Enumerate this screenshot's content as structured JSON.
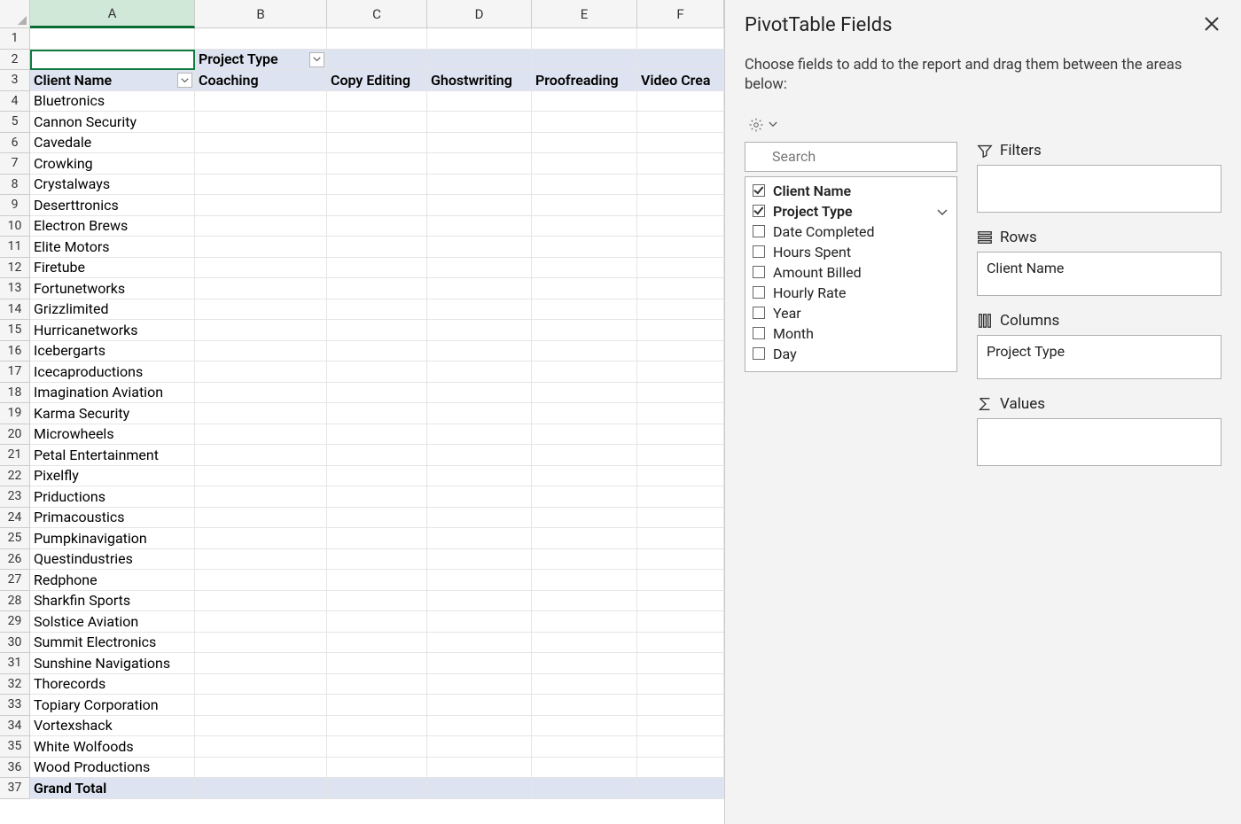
{
  "pane": {
    "title": "PivotTable Fields",
    "subtitle": "Choose fields to add to the report and drag them between the areas below:",
    "search_placeholder": "Search",
    "fields": [
      {
        "label": "Client Name",
        "checked": true,
        "chevron": false
      },
      {
        "label": "Project Type",
        "checked": true,
        "chevron": true
      },
      {
        "label": "Date Completed",
        "checked": false,
        "chevron": false
      },
      {
        "label": "Hours Spent",
        "checked": false,
        "chevron": false
      },
      {
        "label": "Amount Billed",
        "checked": false,
        "chevron": false
      },
      {
        "label": "Hourly Rate",
        "checked": false,
        "chevron": false
      },
      {
        "label": "Year",
        "checked": false,
        "chevron": false
      },
      {
        "label": "Month",
        "checked": false,
        "chevron": false
      },
      {
        "label": "Day",
        "checked": false,
        "chevron": false
      }
    ],
    "areas": {
      "filters_label": "Filters",
      "rows_label": "Rows",
      "columns_label": "Columns",
      "values_label": "Values",
      "rows_items": [
        "Client Name"
      ],
      "columns_items": [
        "Project Type"
      ]
    }
  },
  "sheet": {
    "columns": [
      "A",
      "B",
      "C",
      "D",
      "E",
      "F"
    ],
    "active_col": "A",
    "pivot": {
      "field_header_row": "Client Name",
      "field_header_col": "Project Type",
      "col_labels": [
        "Coaching",
        "Copy Editing",
        "Ghostwriting",
        "Proofreading",
        "Video Crea"
      ],
      "row_labels": [
        "Bluetronics",
        "Cannon Security",
        "Cavedale",
        "Crowking",
        "Crystalways",
        "Deserttronics",
        "Electron Brews",
        "Elite Motors",
        "Firetube",
        "Fortunetworks",
        "Grizzlimited",
        "Hurricanetworks",
        "Icebergarts",
        "Icecaproductions",
        "Imagination Aviation",
        "Karma Security",
        "Microwheels",
        "Petal Entertainment",
        "Pixelfly",
        "Priductions",
        "Primacoustics",
        "Pumpkinavigation",
        "Questindustries",
        "Redphone",
        "Sharkfin Sports",
        "Solstice Aviation",
        "Summit Electronics",
        "Sunshine Navigations",
        "Thorecords",
        "Topiary Corporation",
        "Vortexshack",
        "White Wolfoods",
        "Wood Productions"
      ],
      "grand_total": "Grand Total"
    }
  }
}
